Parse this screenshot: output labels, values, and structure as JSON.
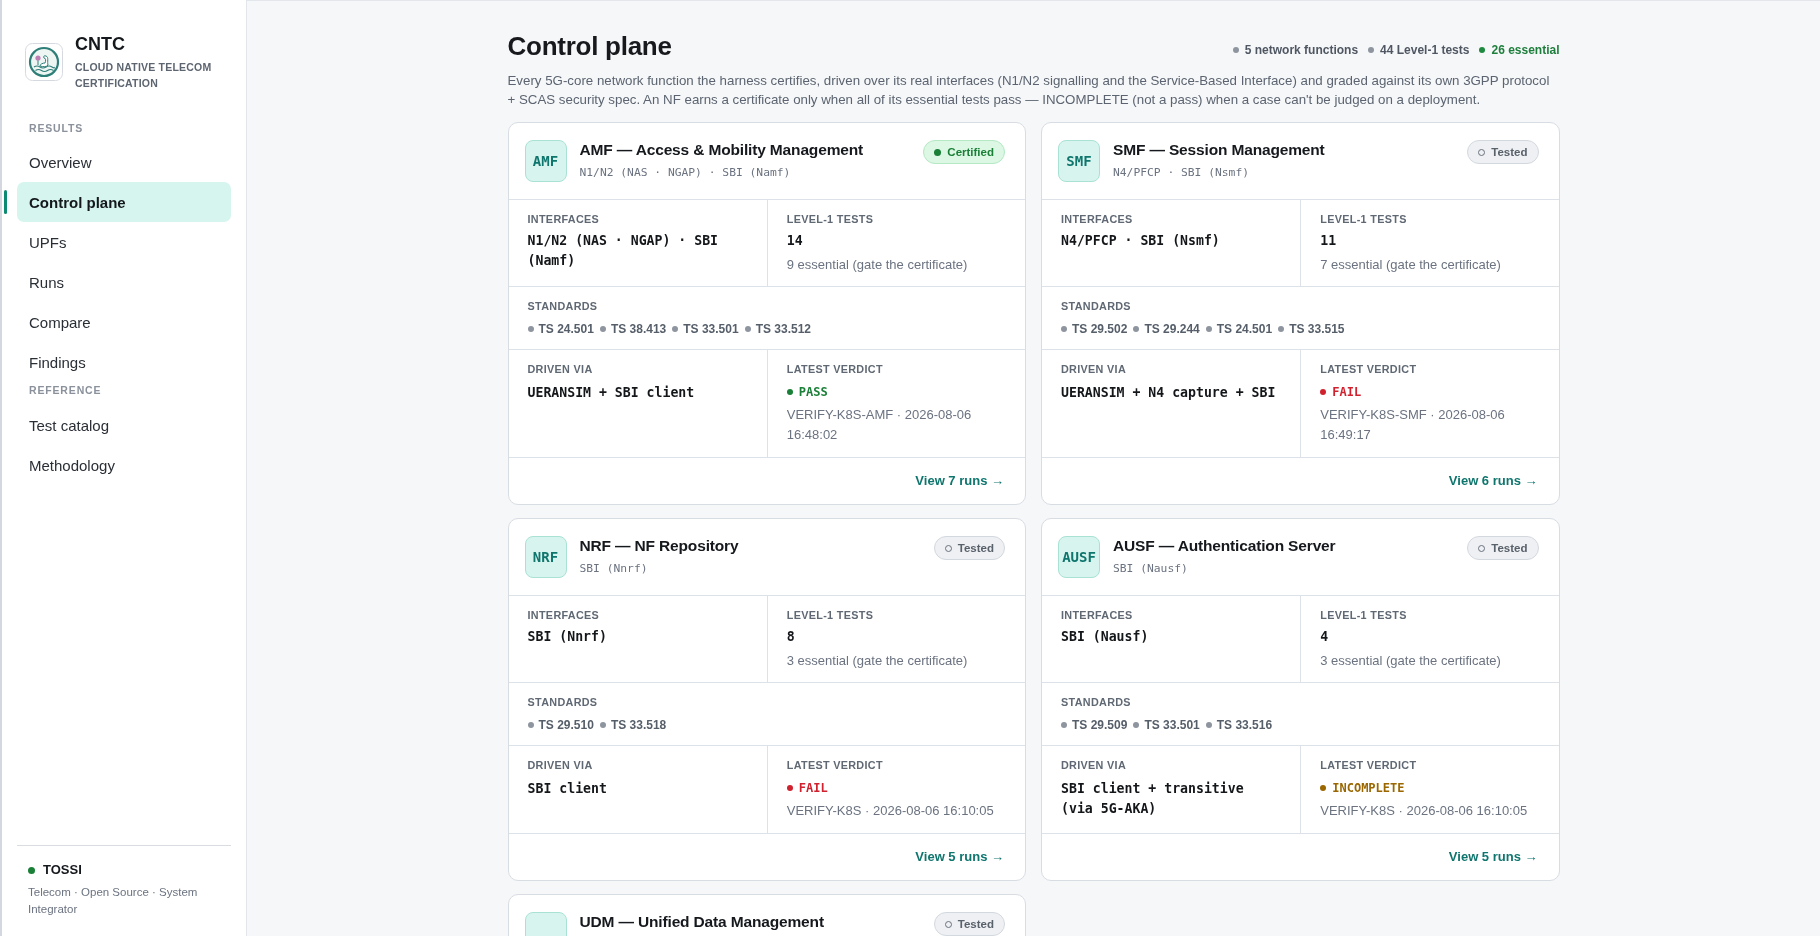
{
  "sidebar": {
    "brand": {
      "name": "CNTC",
      "tagline": "CLOUD NATIVE TELECOM CERTIFICATION"
    },
    "sections": [
      {
        "heading": "RESULTS",
        "items": [
          {
            "label": "Overview",
            "selected": false
          },
          {
            "label": "Control plane",
            "selected": true
          },
          {
            "label": "UPFs",
            "selected": false
          },
          {
            "label": "Runs",
            "selected": false
          },
          {
            "label": "Compare",
            "selected": false
          },
          {
            "label": "Findings",
            "selected": false
          }
        ]
      },
      {
        "heading": "REFERENCE",
        "items": [
          {
            "label": "Test catalog",
            "selected": false
          },
          {
            "label": "Methodology",
            "selected": false
          }
        ]
      }
    ],
    "footer": {
      "name": "TOSSI",
      "description": "Telecom · Open Source · System Integrator"
    }
  },
  "page": {
    "title": "Control plane",
    "stats": [
      {
        "text": "5 network functions",
        "kind": "neutral"
      },
      {
        "text": "44 Level-1 tests",
        "kind": "neutral"
      },
      {
        "text": "26 essential",
        "kind": "positive"
      }
    ],
    "description": "Every 5G-core network function the harness certifies, driven over its real interfaces (N1/N2 signalling and the Service-Based Interface) and graded against its own 3GPP protocol + SCAS security spec. An NF earns a certificate only when all of its essential tests pass — INCOMPLETE (not a pass) when a case can't be judged on a deployment."
  },
  "cards": [
    {
      "code": "AMF",
      "title": "AMF — Access & Mobility Management",
      "subtitle": "N1/N2 (NAS · NGAP) · SBI (Namf)",
      "badge": {
        "label": "Certified",
        "kind": "certified"
      },
      "interfaces": {
        "label": "INTERFACES",
        "value": "N1/N2 (NAS · NGAP) · SBI (Namf)"
      },
      "tests": {
        "label": "LEVEL-1 TESTS",
        "count": "14",
        "note": "9 essential (gate the certificate)"
      },
      "standards": {
        "label": "STANDARDS",
        "items": [
          "TS 24.501",
          "TS 38.413",
          "TS 33.501",
          "TS 33.512"
        ]
      },
      "driven": {
        "label": "DRIVEN VIA",
        "value": "UERANSIM + SBI client"
      },
      "verdict": {
        "label": "LATEST VERDICT",
        "kind": "pass",
        "text": "PASS",
        "detail": "VERIFY-K8S-AMF · 2026-08-06 16:48:02"
      },
      "link": "View 7 runs →"
    },
    {
      "code": "SMF",
      "title": "SMF — Session Management",
      "subtitle": "N4/PFCP · SBI (Nsmf)",
      "badge": {
        "label": "Tested",
        "kind": "tested"
      },
      "interfaces": {
        "label": "INTERFACES",
        "value": "N4/PFCP · SBI (Nsmf)"
      },
      "tests": {
        "label": "LEVEL-1 TESTS",
        "count": "11",
        "note": "7 essential (gate the certificate)"
      },
      "standards": {
        "label": "STANDARDS",
        "items": [
          "TS 29.502",
          "TS 29.244",
          "TS 24.501",
          "TS 33.515"
        ]
      },
      "driven": {
        "label": "DRIVEN VIA",
        "value": "UERANSIM + N4 capture + SBI"
      },
      "verdict": {
        "label": "LATEST VERDICT",
        "kind": "fail",
        "text": "FAIL",
        "detail": "VERIFY-K8S-SMF · 2026-08-06 16:49:17"
      },
      "link": "View 6 runs →"
    },
    {
      "code": "NRF",
      "title": "NRF — NF Repository",
      "subtitle": "SBI (Nnrf)",
      "badge": {
        "label": "Tested",
        "kind": "tested"
      },
      "interfaces": {
        "label": "INTERFACES",
        "value": "SBI (Nnrf)"
      },
      "tests": {
        "label": "LEVEL-1 TESTS",
        "count": "8",
        "note": "3 essential (gate the certificate)"
      },
      "standards": {
        "label": "STANDARDS",
        "items": [
          "TS 29.510",
          "TS 33.518"
        ]
      },
      "driven": {
        "label": "DRIVEN VIA",
        "value": "SBI client"
      },
      "verdict": {
        "label": "LATEST VERDICT",
        "kind": "fail",
        "text": "FAIL",
        "detail": "VERIFY-K8S · 2026-08-06 16:10:05"
      },
      "link": "View 5 runs →"
    },
    {
      "code": "AUSF",
      "title": "AUSF — Authentication Server",
      "subtitle": "SBI (Nausf)",
      "badge": {
        "label": "Tested",
        "kind": "tested"
      },
      "interfaces": {
        "label": "INTERFACES",
        "value": "SBI (Nausf)"
      },
      "tests": {
        "label": "LEVEL-1 TESTS",
        "count": "4",
        "note": "3 essential (gate the certificate)"
      },
      "standards": {
        "label": "STANDARDS",
        "items": [
          "TS 29.509",
          "TS 33.501",
          "TS 33.516"
        ]
      },
      "driven": {
        "label": "DRIVEN VIA",
        "value": "SBI client + transitive (via 5G-AKA)"
      },
      "verdict": {
        "label": "LATEST VERDICT",
        "kind": "incomplete",
        "text": "INCOMPLETE",
        "detail": "VERIFY-K8S · 2026-08-06 16:10:05"
      },
      "link": "View 5 runs →"
    },
    {
      "title": "UDM — Unified Data Management",
      "badge": {
        "label": "Tested",
        "kind": "tested"
      }
    }
  ]
}
